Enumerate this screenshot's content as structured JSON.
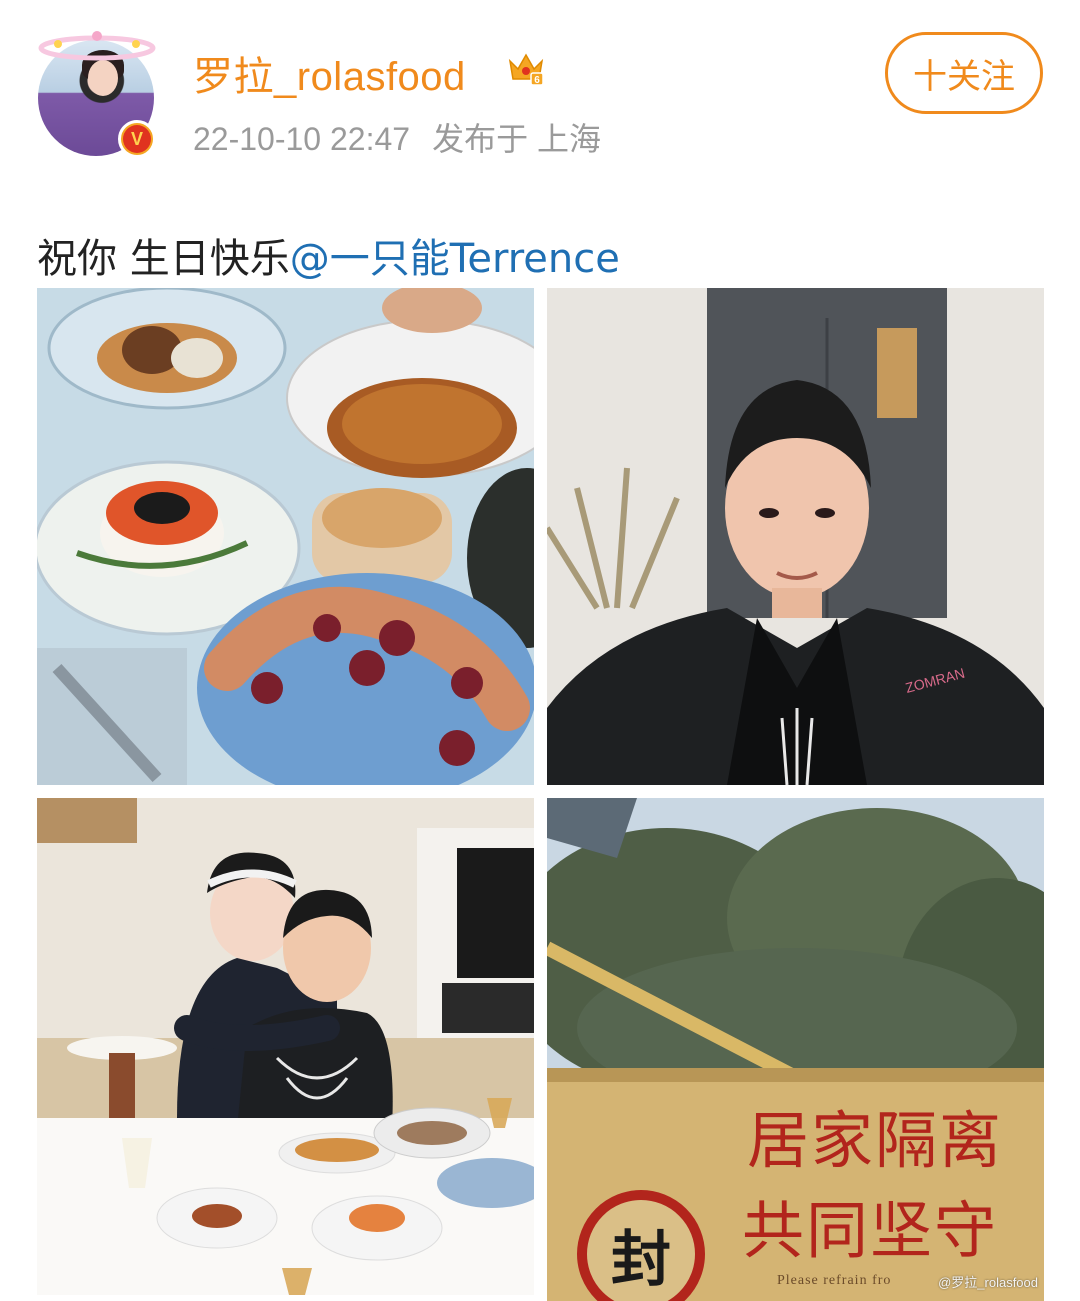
{
  "header": {
    "username": "罗拉_rolasfood",
    "timestamp": "22-10-10 22:47",
    "location": "发布于 上海",
    "follow_label": "十关注",
    "verified_badge": "V",
    "accent_color": "#f08a1c",
    "icons": [
      "avatar",
      "verified-v-icon",
      "crown-level-icon"
    ]
  },
  "post": {
    "text_plain": "祝你 生日快乐",
    "mention": "@一只能Terrence",
    "mention_color": "#1f6fb3"
  },
  "photos": {
    "p1": {
      "name": "food-table-photo"
    },
    "p2": {
      "name": "man-portrait-photo"
    },
    "p3": {
      "name": "couple-dinner-photo"
    },
    "p4": {
      "name": "quarantine-sign-photo",
      "sign_line1": "居家隔离",
      "sign_line2": "共同坚守",
      "seal_char": "封",
      "refrain_text": "Please refrain fro",
      "watermark": "@罗拉_rolasfood"
    }
  }
}
